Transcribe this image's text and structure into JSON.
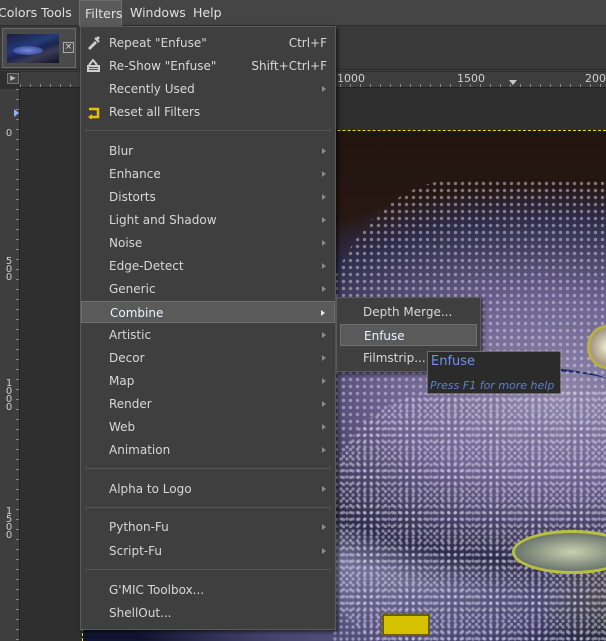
{
  "menubar": {
    "items": [
      {
        "label": "Colors"
      },
      {
        "label": "Tools"
      },
      {
        "label": "Filters"
      },
      {
        "label": "Windows"
      },
      {
        "label": "Help"
      }
    ]
  },
  "image_tab": {
    "close_icon": "close-icon"
  },
  "ruler": {
    "h_labels": [
      "1000",
      "1500",
      "200"
    ],
    "v_labels": [
      "0",
      "5\n0\n0",
      "1\n0\n0\n0",
      "1\n5\n0\n0"
    ]
  },
  "filters_menu": {
    "repeat": {
      "label": "Repeat \"Enfuse\"",
      "shortcut": "Ctrl+F",
      "icon": "repeat-filter-icon"
    },
    "reshow": {
      "label": "Re-Show \"Enfuse\"",
      "shortcut": "Shift+Ctrl+F",
      "icon": "reshow-filter-icon"
    },
    "recently_used": {
      "label": "Recently Used"
    },
    "reset": {
      "label": "Reset all Filters",
      "icon": "reset-filters-icon"
    },
    "items": [
      {
        "label": "Blur"
      },
      {
        "label": "Enhance"
      },
      {
        "label": "Distorts"
      },
      {
        "label": "Light and Shadow"
      },
      {
        "label": "Noise"
      },
      {
        "label": "Edge-Detect"
      },
      {
        "label": "Generic"
      },
      {
        "label": "Combine"
      },
      {
        "label": "Artistic"
      },
      {
        "label": "Decor"
      },
      {
        "label": "Map"
      },
      {
        "label": "Render"
      },
      {
        "label": "Web"
      },
      {
        "label": "Animation"
      }
    ],
    "alpha_to_logo": {
      "label": "Alpha to Logo"
    },
    "python_fu": {
      "label": "Python-Fu"
    },
    "script_fu": {
      "label": "Script-Fu"
    },
    "gmic": {
      "label": "G'MIC Toolbox..."
    },
    "shellout": {
      "label": "ShellOut..."
    }
  },
  "combine_menu": {
    "items": [
      {
        "label": "Depth Merge..."
      },
      {
        "label": "Enfuse"
      },
      {
        "label": "Filmstrip..."
      }
    ]
  },
  "tooltip": {
    "title": "Enfuse",
    "help": "Press F1 for more help"
  }
}
